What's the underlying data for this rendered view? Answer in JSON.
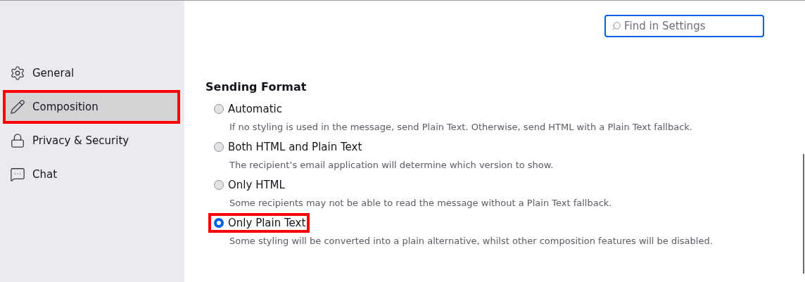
{
  "sidebar": {
    "items": [
      {
        "label": "General",
        "kind": "gear",
        "selected": false,
        "highlighted": false
      },
      {
        "label": "Composition",
        "kind": "pencil",
        "selected": true,
        "highlighted": true
      },
      {
        "label": "Privacy & Security",
        "kind": "lock",
        "selected": false,
        "highlighted": false
      },
      {
        "label": "Chat",
        "kind": "chat",
        "selected": false,
        "highlighted": false
      }
    ]
  },
  "search": {
    "placeholder": "Find in Settings"
  },
  "section": {
    "title": "Sending Format",
    "options": [
      {
        "label": "Automatic",
        "description": "If no styling is used in the message, send Plain Text. Otherwise, send HTML with a Plain Text fallback.",
        "selected": false,
        "highlighted": false
      },
      {
        "label": "Both HTML and Plain Text",
        "description": "The recipient’s email application will determine which version to show.",
        "selected": false,
        "highlighted": false
      },
      {
        "label": "Only HTML",
        "description": "Some recipients may not be able to read the message without a Plain Text fallback.",
        "selected": false,
        "highlighted": false
      },
      {
        "label": "Only Plain Text",
        "description": "Some styling will be converted into a plain alternative, whilst other composition features will be disabled.",
        "selected": true,
        "highlighted": true
      }
    ]
  }
}
